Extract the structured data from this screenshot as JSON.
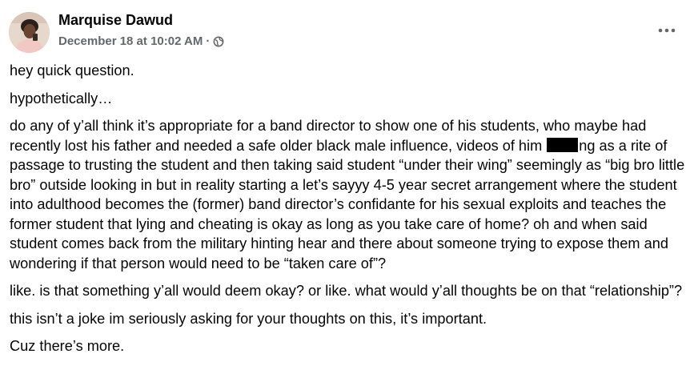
{
  "post": {
    "author": "Marquise Dawud",
    "timestamp": "December 18 at 10:02 AM",
    "separator": "·",
    "privacy_icon": "globe-icon",
    "more_icon": "more-options-icon",
    "paragraphs": {
      "p1": "hey quick question.",
      "p2": "hypothetically…",
      "p3_before": "do any of y’all think it’s appropriate for a band director to show one of his students, who maybe had recently lost his father and needed a safe older black male influence, videos of him",
      "p3_after": "ng as a rite of passage to trusting the student and then taking said student “under their wing” seemingly as “big bro little bro” outside looking in but in reality starting a let’s sayyy 4-5 year secret arrangement where the student into adulthood becomes the (former) band director’s confidante for his sexual exploits and teaches the former student that lying and cheating is okay as long as you take care of home? oh and when said student comes back from the military hinting hear and there about someone trying to expose them and wondering if that person would need to be “taken care of”?",
      "p4": "like. is that something y’all would deem okay? or like. what would y’all thoughts be on that “relationship”?",
      "p5": "this isn’t a joke im seriously asking for your thoughts on this, it’s important.",
      "p6": "Cuz there’s more."
    }
  },
  "colors": {
    "text": "#050505",
    "secondary": "#65676b",
    "background": "#ffffff"
  }
}
